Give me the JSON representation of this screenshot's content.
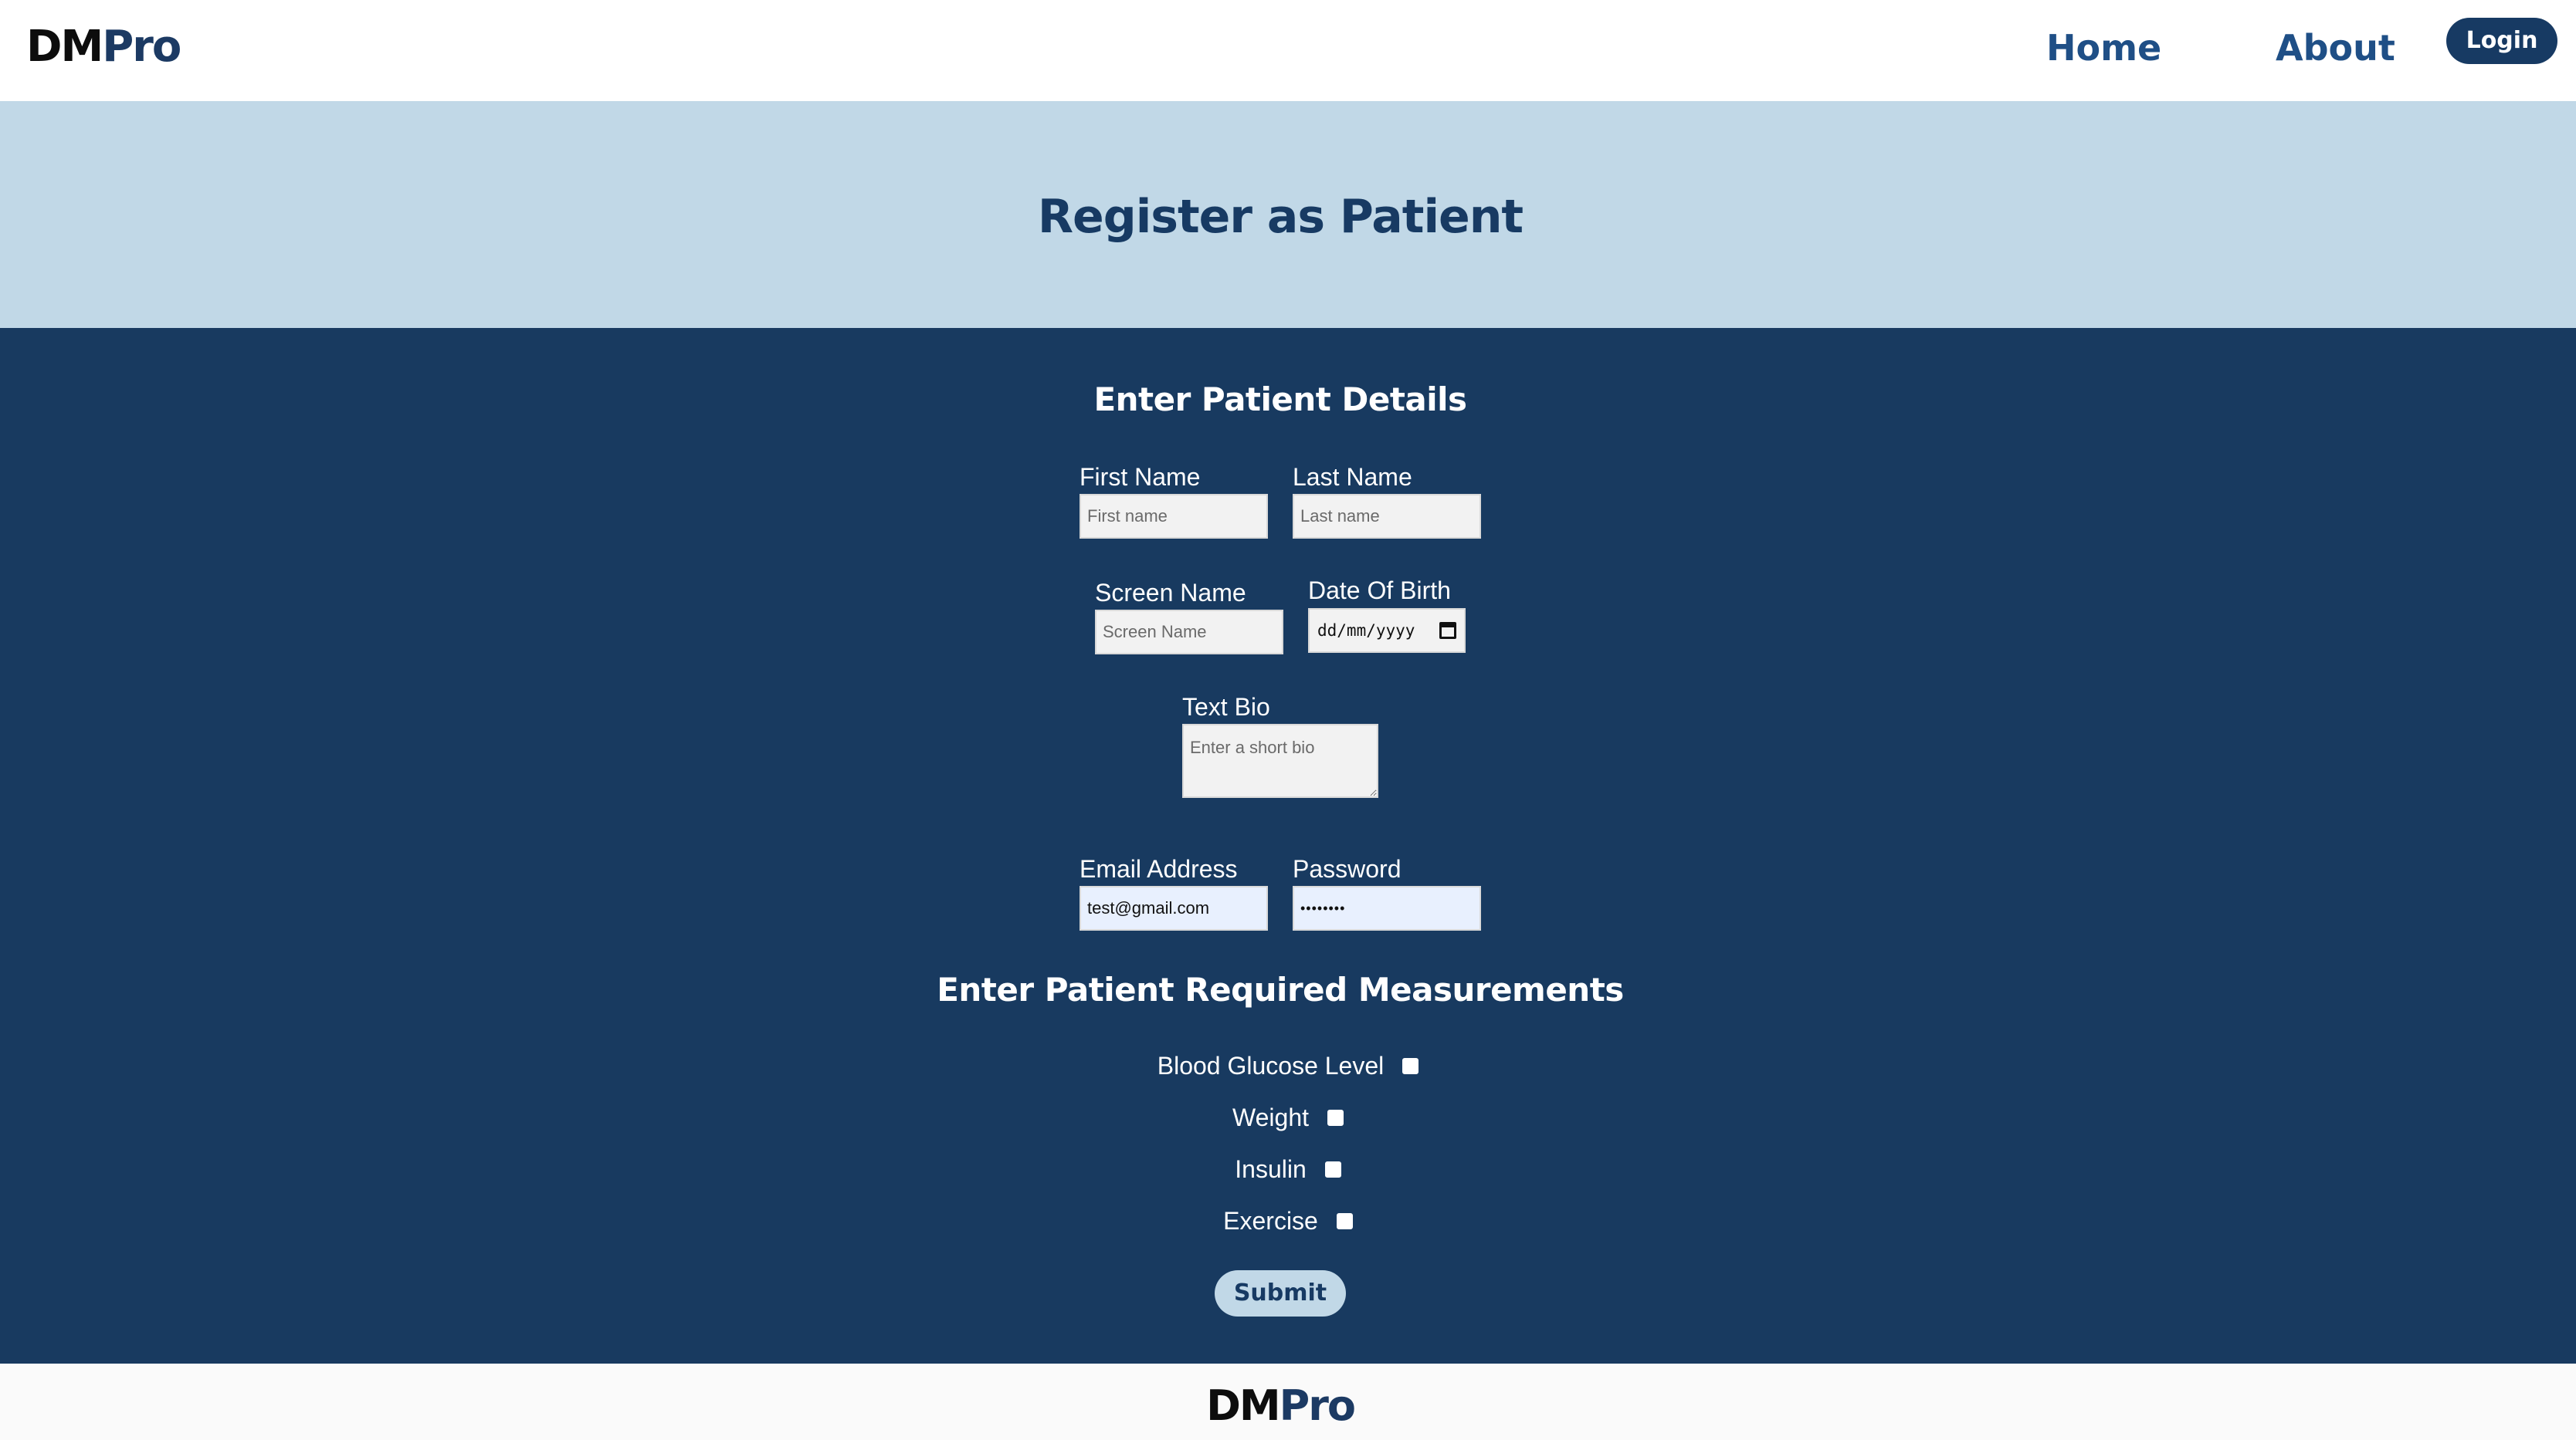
{
  "header": {
    "logo_dm": "DM",
    "logo_pro": "Pro",
    "nav_home": "Home",
    "nav_about": "About",
    "login_label": "Login"
  },
  "hero": {
    "title": "Register as Patient"
  },
  "details": {
    "title": "Enter Patient Details",
    "first_name": {
      "label": "First Name",
      "placeholder": "First name",
      "value": ""
    },
    "last_name": {
      "label": "Last Name",
      "placeholder": "Last name",
      "value": ""
    },
    "screen_name": {
      "label": "Screen Name",
      "placeholder": "Screen Name",
      "value": ""
    },
    "dob": {
      "label": "Date Of Birth",
      "display": "dd/mm/yyyy"
    },
    "bio": {
      "label": "Text Bio",
      "placeholder": "Enter a short bio"
    },
    "email": {
      "label": "Email Address",
      "value": "test@gmail.com"
    },
    "password": {
      "label": "Password",
      "value": "••••••••"
    }
  },
  "measurements": {
    "title": "Enter Patient Required Measurements",
    "items": [
      {
        "label": "Blood Glucose Level",
        "checked": false
      },
      {
        "label": "Weight",
        "checked": false
      },
      {
        "label": "Insulin",
        "checked": false
      },
      {
        "label": "Exercise",
        "checked": false
      }
    ]
  },
  "submit_label": "Submit",
  "footer": {
    "logo_dm": "DM",
    "logo_pro": "Pro"
  },
  "colors": {
    "navy": "#183a60",
    "hero_bg": "#c1d8e7",
    "nav_link": "#1f4f86"
  }
}
